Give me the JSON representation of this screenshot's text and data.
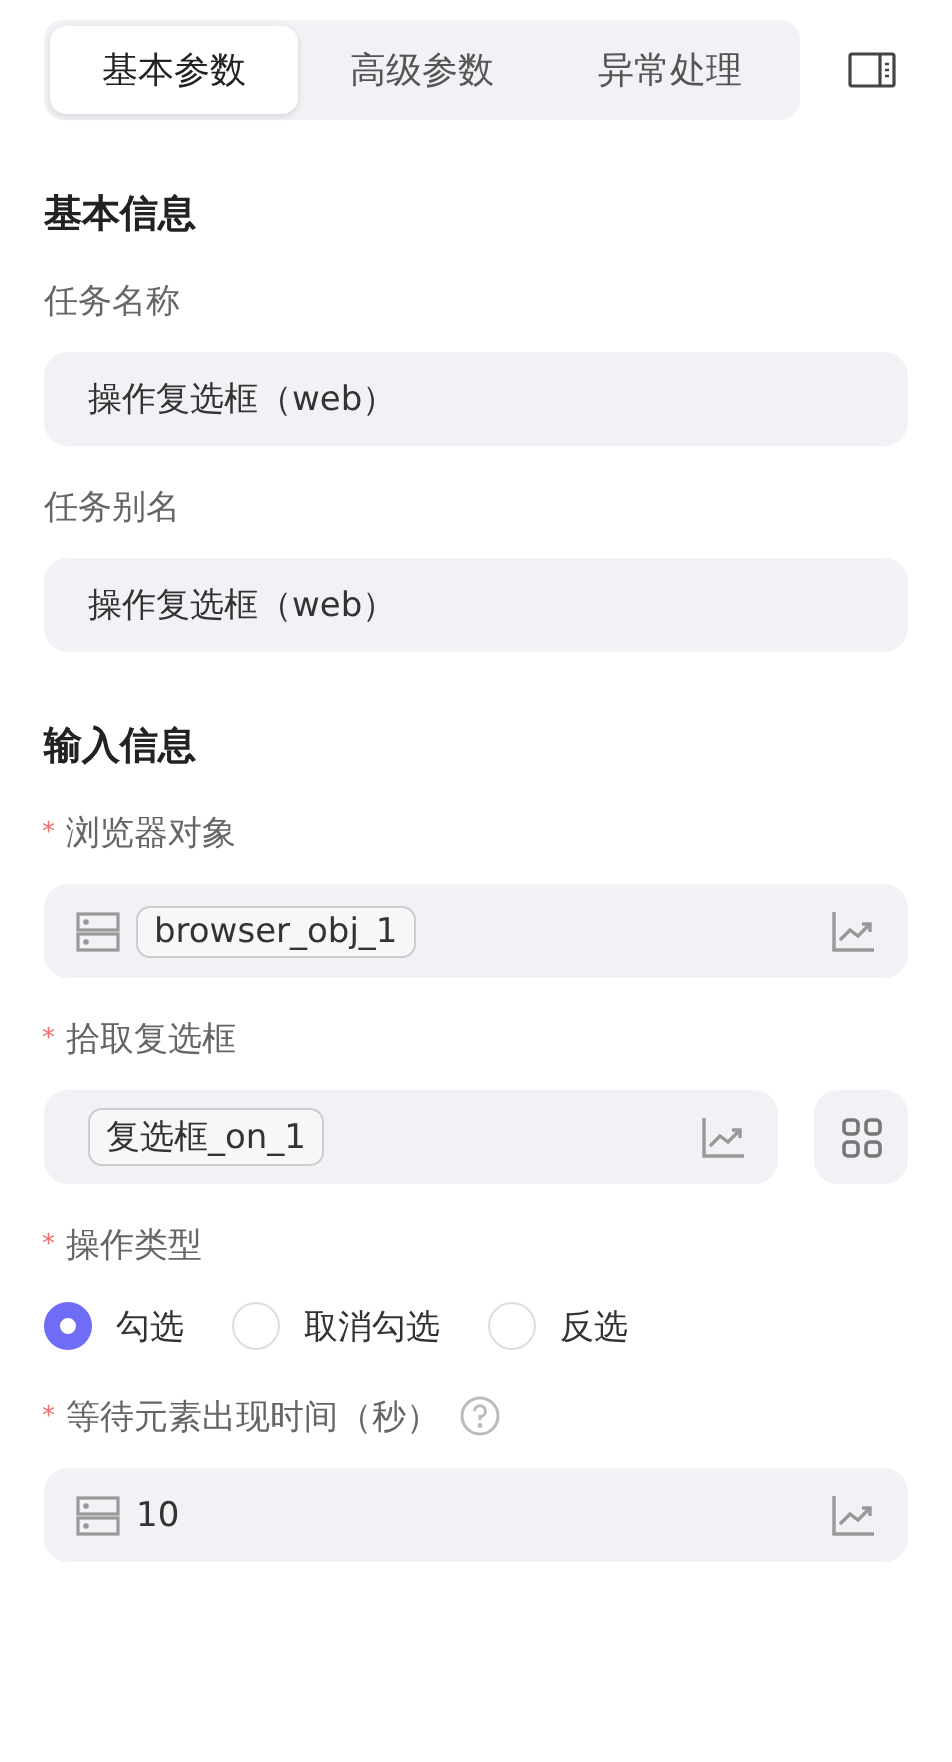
{
  "tabs": [
    {
      "label": "基本参数",
      "selected": true
    },
    {
      "label": "高级参数",
      "selected": false
    },
    {
      "label": "异常处理",
      "selected": false
    }
  ],
  "sections": [
    {
      "title": "基本信息",
      "fields": [
        {
          "kind": "text",
          "label": "任务名称",
          "value": "操作复选框（web）"
        },
        {
          "kind": "text",
          "label": "任务别名",
          "value": "操作复选框（web）"
        }
      ]
    },
    {
      "title": "输入信息",
      "fields": [
        {
          "kind": "chip",
          "label": "浏览器对象",
          "required_mark": "*",
          "prefix_icon": true,
          "chip": "browser_obj_1",
          "picker": false
        },
        {
          "kind": "chip",
          "label": "拾取复选框",
          "required_mark": "*",
          "prefix_icon": false,
          "chip": "复选框_on_1",
          "picker": true
        },
        {
          "kind": "radio",
          "label": "操作类型",
          "required_mark": "*",
          "options": [
            {
              "label": "勾选",
              "selected": true
            },
            {
              "label": "取消勾选",
              "selected": false
            },
            {
              "label": "反选",
              "selected": false
            }
          ]
        },
        {
          "kind": "number",
          "label": "等待元素出现时间（秒）",
          "required_mark": "*",
          "help": true,
          "prefix_icon": true,
          "value": "10"
        }
      ]
    }
  ]
}
